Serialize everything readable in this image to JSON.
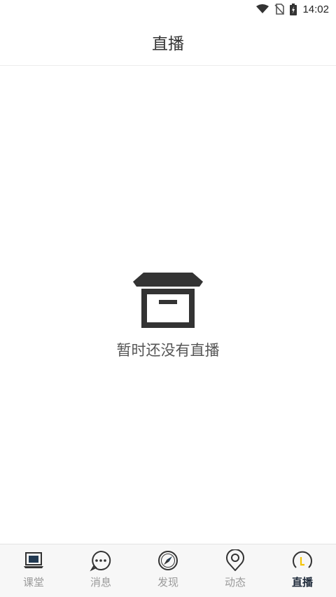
{
  "status_bar": {
    "time": "14:02",
    "icons": [
      "wifi-icon",
      "no-sim-icon",
      "battery-charging-icon"
    ]
  },
  "header": {
    "title": "直播"
  },
  "empty_state": {
    "icon": "archive-box-icon",
    "message": "暂时还没有直播"
  },
  "tabs": [
    {
      "label": "课堂",
      "icon": "laptop-icon",
      "active": false
    },
    {
      "label": "消息",
      "icon": "chat-bubble-icon",
      "active": false
    },
    {
      "label": "发现",
      "icon": "compass-icon",
      "active": false
    },
    {
      "label": "动态",
      "icon": "location-pin-icon",
      "active": false
    },
    {
      "label": "直播",
      "icon": "live-clock-icon",
      "active": true
    }
  ],
  "colors": {
    "icon_dark": "#333333",
    "active_tab_text": "#1e2a3a",
    "inactive_tab_text": "#9a9a9a",
    "accent_yellow": "#f5c400"
  }
}
